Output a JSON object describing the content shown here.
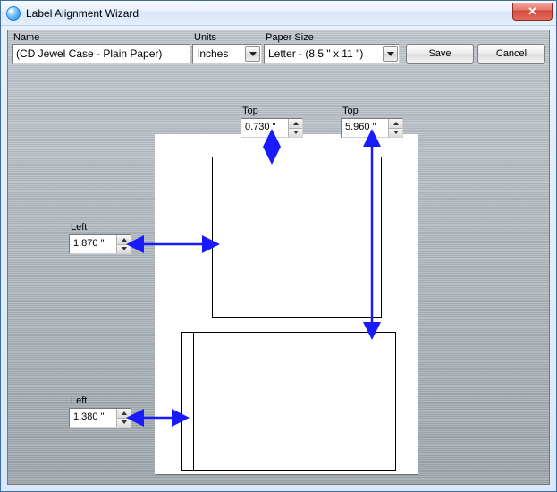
{
  "window": {
    "title": "Label Alignment Wizard"
  },
  "toolbar": {
    "name_label": "Name",
    "name_value": "(CD Jewel Case - Plain Paper)",
    "units_label": "Units",
    "units_value": "Inches",
    "paper_label": "Paper Size",
    "paper_value": "Letter - (8.5 \" x 11 \")",
    "save_label": "Save",
    "cancel_label": "Cancel"
  },
  "measurements": {
    "top1_label": "Top",
    "top1_value": "0.730 \"",
    "top2_label": "Top",
    "top2_value": "5.960 \"",
    "left1_label": "Left",
    "left1_value": "1.870 \"",
    "left2_label": "Left",
    "left2_value": "1.380 \""
  },
  "colors": {
    "arrow": "#1a1aff"
  }
}
